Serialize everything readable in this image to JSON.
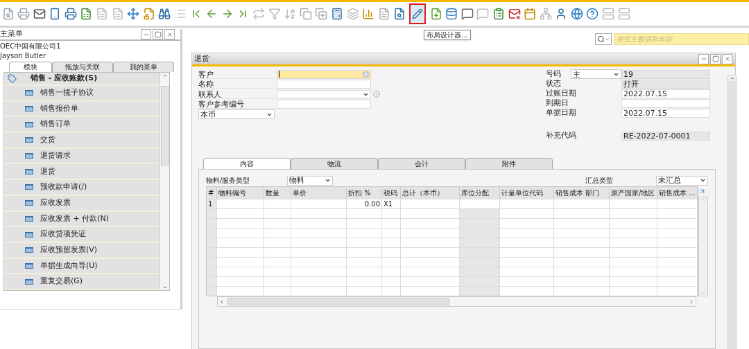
{
  "tooltip": "布局设计器...",
  "search": {
    "placeholder": "查找主数据和单据"
  },
  "main_menu": {
    "title": "主菜单",
    "company": "OEC中国有限公司1",
    "user": "Jayson Butler",
    "tabs": [
      {
        "label": "模块",
        "selected": true
      },
      {
        "label": "拖放与关联",
        "selected": false
      },
      {
        "label": "我的菜单",
        "selected": false
      }
    ],
    "module": "销售 - 应收账款(S)",
    "items": [
      "销售一揽子协议",
      "销售报价单",
      "销售订单",
      "交货",
      "退货请求",
      "退货",
      "预收款申请(/)",
      "应收发票",
      "应收发票 + 付款(N)",
      "应收贷项凭证",
      "应收预留发票(V)",
      "单据生成向导(U)",
      "重复交易(G)"
    ]
  },
  "document": {
    "title": "退货",
    "left_fields": [
      {
        "label": "客户",
        "kind": "lookup",
        "focused": true
      },
      {
        "label": "名称",
        "kind": "text",
        "focused": false
      },
      {
        "label": "联系人",
        "kind": "dropdown",
        "focused": false
      },
      {
        "label": "客户参考编号",
        "kind": "text",
        "focused": false
      }
    ],
    "currency": "本币",
    "number": {
      "label": "号码",
      "series": "主",
      "value": "19"
    },
    "right_fields": [
      {
        "label": "状态",
        "value": "打开",
        "readonly": true
      },
      {
        "label": "过账日期",
        "value": "2022.07.15",
        "readonly": false
      },
      {
        "label": "到期日",
        "readonly": false
      },
      {
        "label": "单据日期",
        "value": "2022.07.15",
        "readonly": false
      }
    ],
    "extra_code": {
      "label": "补充代码",
      "value": "RE-2022-07-0001",
      "readonly": true
    },
    "tabs": [
      {
        "label": "内容",
        "selected": true
      },
      {
        "label": "物流",
        "selected": false
      },
      {
        "label": "会计",
        "selected": false
      },
      {
        "label": "附件",
        "selected": false
      }
    ],
    "item_type": {
      "label": "物料/服务类型",
      "value": "物料"
    },
    "summary_type": {
      "label": "汇总类型",
      "value": "未汇总"
    },
    "table": {
      "columns": [
        {
          "label": "#",
          "disabled": true
        },
        {
          "label": "物料编号",
          "disabled": false
        },
        {
          "label": "数量",
          "disabled": false
        },
        {
          "label": "单价",
          "disabled": false
        },
        {
          "label": "折扣 %",
          "disabled": false
        },
        {
          "label": "税码",
          "disabled": false
        },
        {
          "label": "总计（本币）",
          "disabled": false
        },
        {
          "label": "库位分配",
          "disabled": true
        },
        {
          "label": "计量单位代码",
          "disabled": false
        },
        {
          "label": "销售成本 部门",
          "disabled": false
        },
        {
          "label": "原产国家/地区",
          "disabled": false
        },
        {
          "label": "销售成本 ...",
          "disabled": false
        }
      ],
      "rows": [
        {
          "cells": [
            "1",
            null,
            null,
            null,
            "0.00",
            "X1",
            null,
            null,
            null,
            null,
            null,
            null
          ]
        }
      ]
    }
  }
}
